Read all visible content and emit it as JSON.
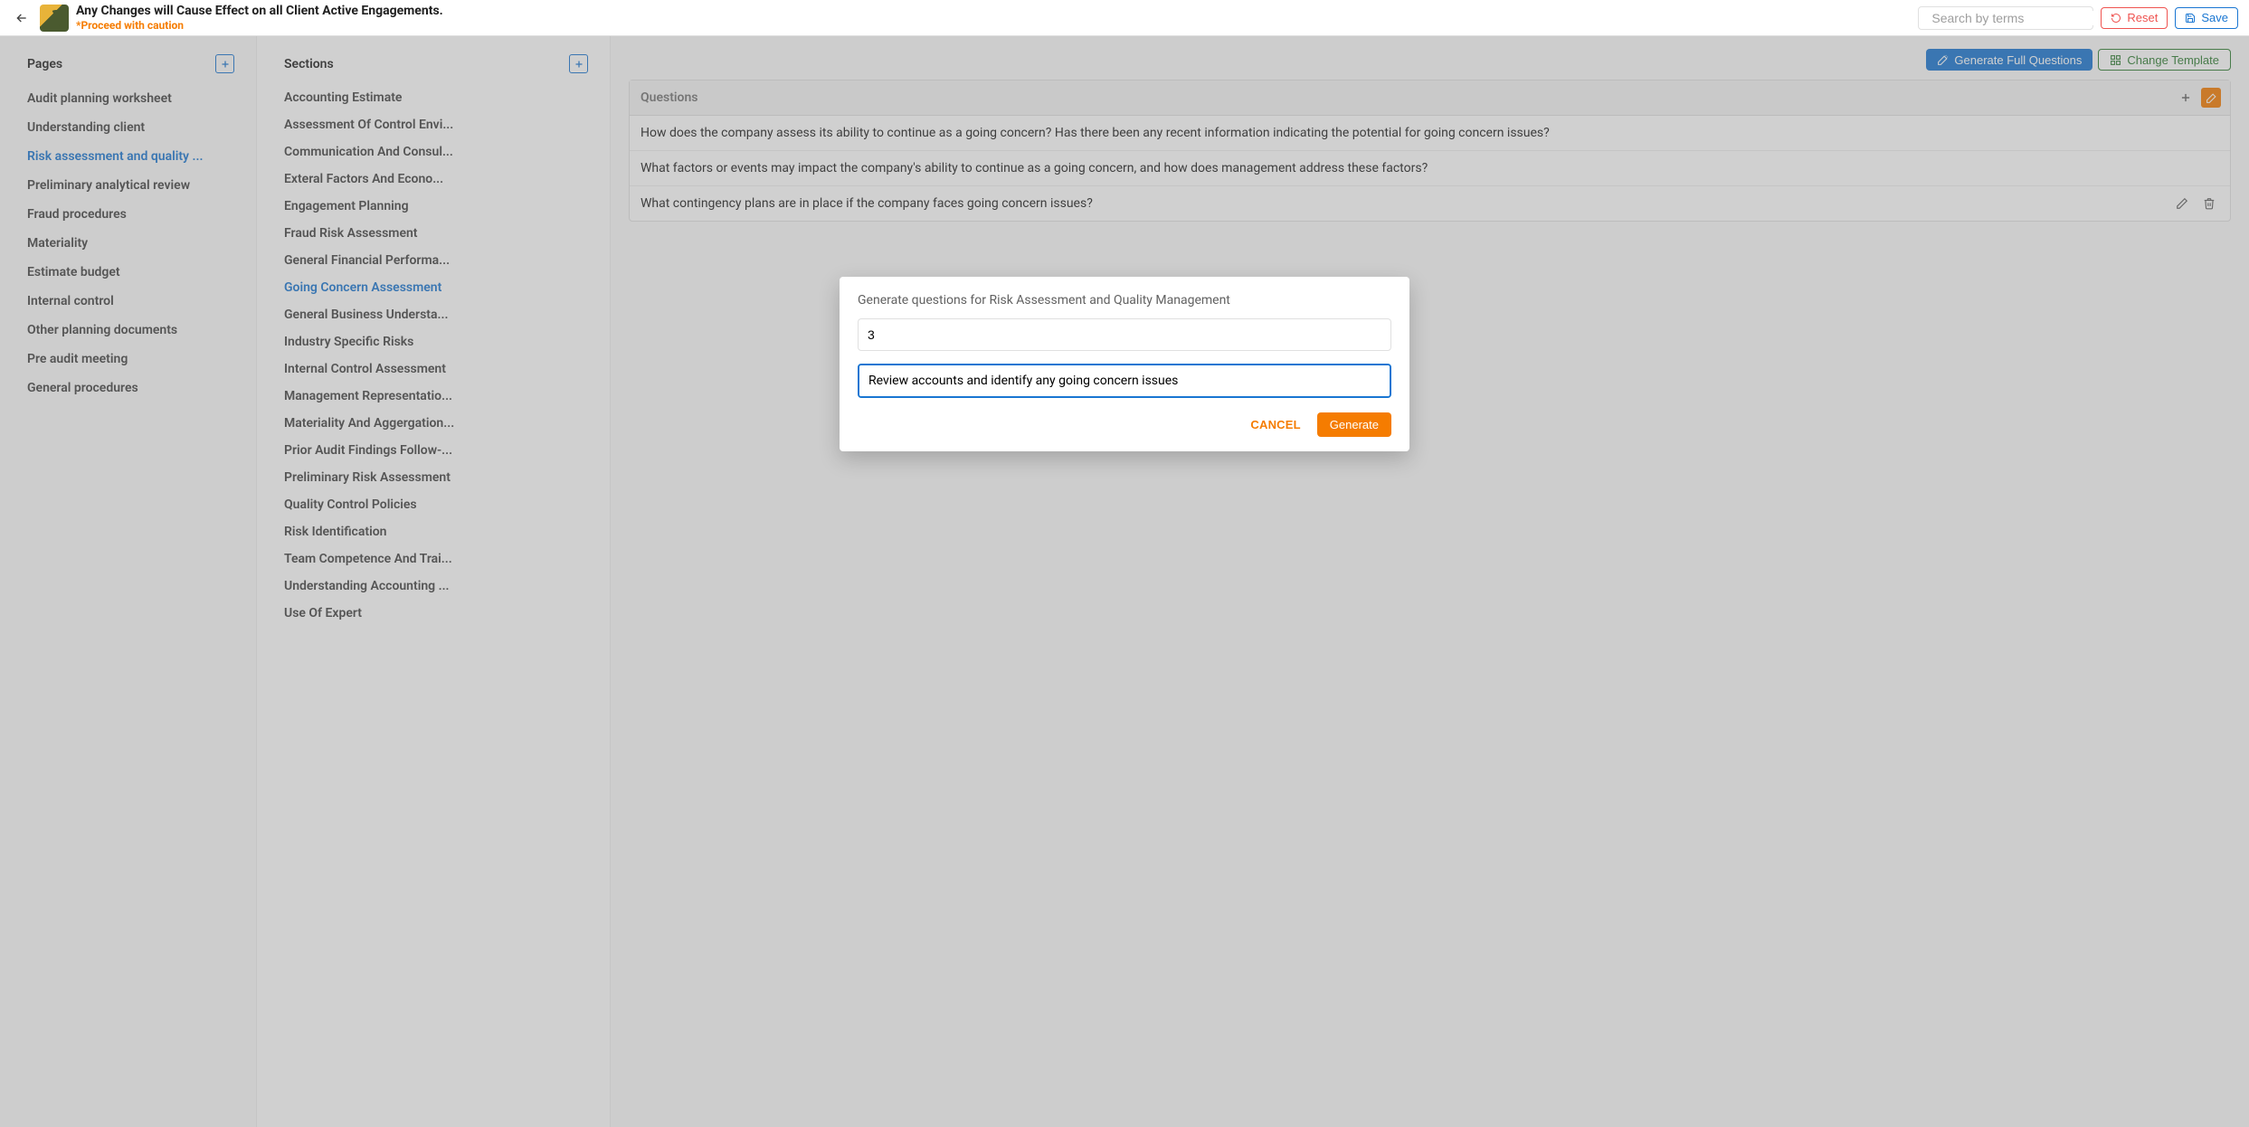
{
  "header": {
    "title": "Any Changes will Cause Effect on all Client Active Engagements.",
    "subtitle": "*Proceed with caution",
    "search_placeholder": "Search by terms",
    "reset_label": "Reset",
    "save_label": "Save"
  },
  "pages": {
    "title": "Pages",
    "items": [
      "Audit planning worksheet",
      "Understanding client",
      "Risk assessment and quality ...",
      "Preliminary analytical review",
      "Fraud procedures",
      "Materiality",
      "Estimate budget",
      "Internal control",
      "Other planning documents",
      "Pre audit meeting",
      "General procedures"
    ],
    "active_index": 2
  },
  "sections": {
    "title": "Sections",
    "items": [
      "Accounting Estimate",
      "Assessment Of Control Envi...",
      "Communication And Consul...",
      "Exteral Factors And Econo...",
      "Engagement Planning",
      "Fraud Risk Assessment",
      "General Financial Performa...",
      "Going Concern Assessment",
      "General Business Understa...",
      "Industry Specific Risks",
      "Internal Control Assessment",
      "Management Representatio...",
      "Materiality And Aggergation...",
      "Prior Audit Findings Follow-...",
      "Preliminary Risk Assessment",
      "Quality Control Policies",
      "Risk Identification",
      "Team Competence And Trai...",
      "Understanding Accounting ...",
      "Use Of Expert"
    ],
    "active_index": 7
  },
  "main": {
    "generate_full_label": "Generate Full Questions",
    "change_template_label": "Change Template",
    "questions_title": "Questions",
    "questions": [
      "How does the company assess its ability to continue as a going concern? Has there been any recent information indicating the potential for going concern issues?",
      "What factors or events may impact the company's ability to continue as a going concern, and how does management address these factors?",
      "What contingency plans are in place if the company faces going concern issues?"
    ],
    "actions_visible_index": 2
  },
  "modal": {
    "title": "Generate questions for Risk Assessment and Quality Management",
    "count_value": "3",
    "prompt_value": "Review accounts and identify any going concern issues",
    "cancel_label": "CANCEL",
    "generate_label": "Generate"
  },
  "icons": {
    "back": "arrow-left-icon",
    "search": "search-icon",
    "reset": "refresh-icon",
    "save": "save-icon",
    "plus": "plus-icon",
    "wand": "magic-wand-icon",
    "template": "template-icon",
    "edit": "pencil-icon",
    "delete": "trash-icon"
  }
}
